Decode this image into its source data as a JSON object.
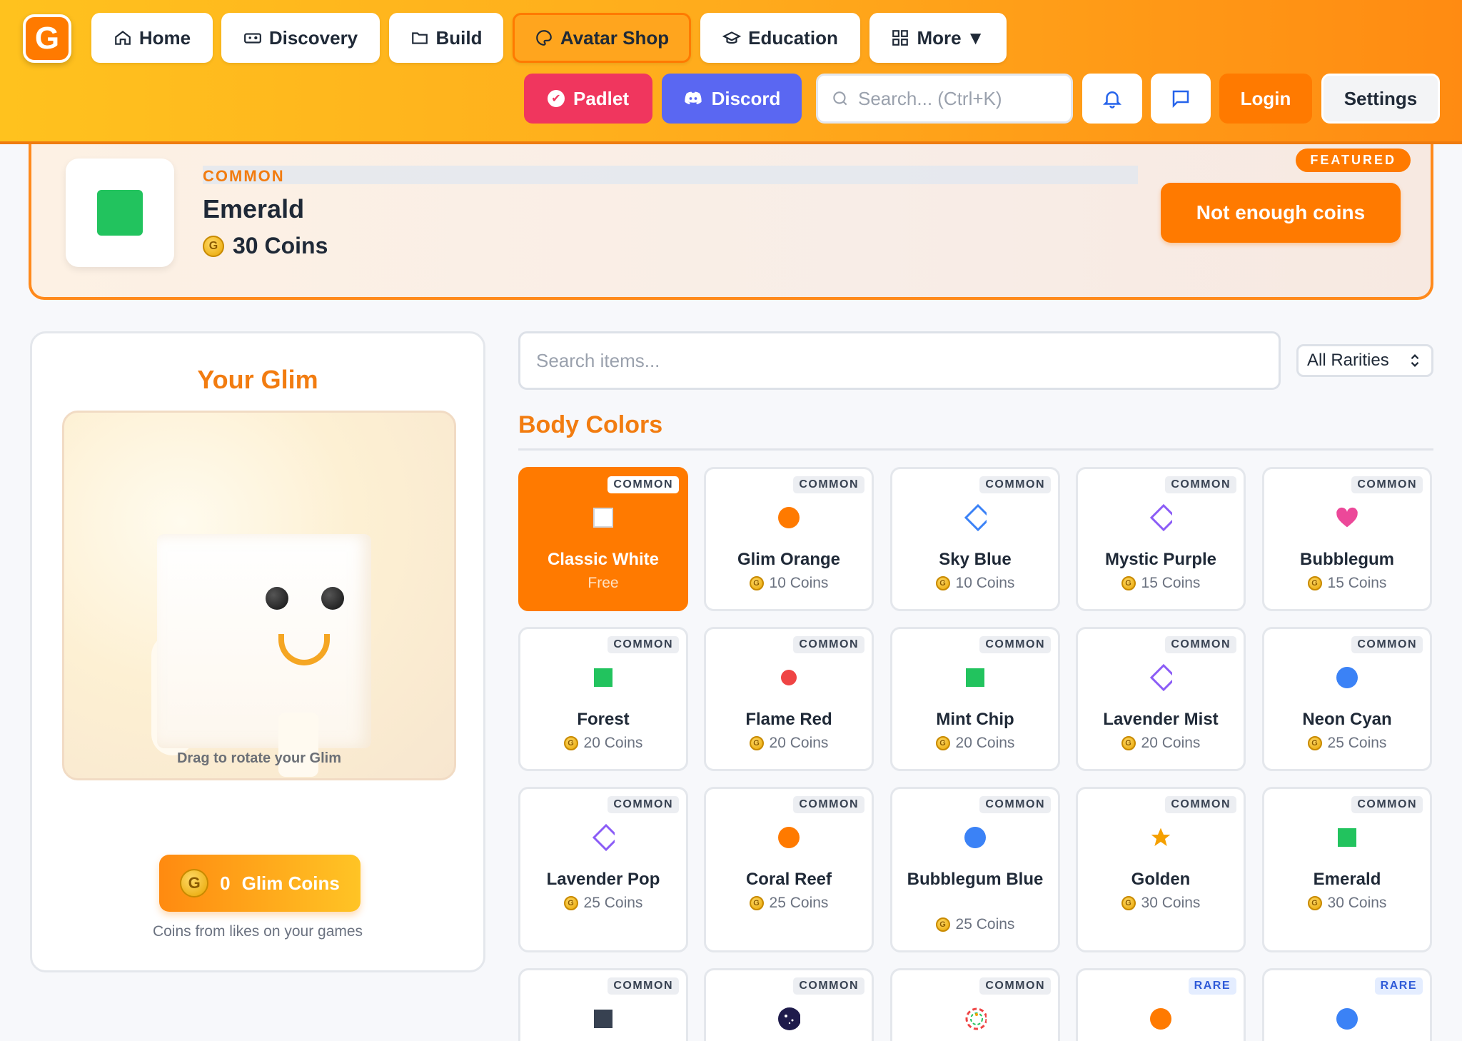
{
  "header": {
    "logo_letter": "G",
    "nav": [
      {
        "label": "Home",
        "icon": "home-icon"
      },
      {
        "label": "Discovery",
        "icon": "gamepad-icon"
      },
      {
        "label": "Build",
        "icon": "folder-icon"
      },
      {
        "label": "Avatar Shop",
        "icon": "palette-icon",
        "active": true
      },
      {
        "label": "Education",
        "icon": "graduation-cap-icon"
      },
      {
        "label": "More ▼",
        "icon": "grid-icon"
      }
    ],
    "padlet_label": "Padlet",
    "discord_label": "Discord",
    "search_placeholder": "Search... (Ctrl+K)",
    "login_label": "Login",
    "settings_label": "Settings"
  },
  "featured": {
    "badge": "FEATURED",
    "rarity": "COMMON",
    "name": "Emerald",
    "price": "30 Coins",
    "color": "#22c35e",
    "button_label": "Not enough coins"
  },
  "glim": {
    "title": "Your Glim",
    "drag_hint": "Drag to rotate your Glim",
    "coins_count": "0",
    "coins_label": "Glim Coins",
    "caption": "Coins from likes on your games"
  },
  "shop": {
    "search_placeholder": "Search items...",
    "rarity_filter": "All Rarities",
    "section_title": "Body Colors",
    "items": [
      {
        "name": "Classic White",
        "price": "Free",
        "rarity": "COMMON",
        "shape": "square-outline",
        "color": "#ffffff",
        "selected": true
      },
      {
        "name": "Glim Orange",
        "price": "10 Coins",
        "rarity": "COMMON",
        "shape": "circle",
        "color": "#ff7a00"
      },
      {
        "name": "Sky Blue",
        "price": "10 Coins",
        "rarity": "COMMON",
        "shape": "diamond",
        "color": "#3b82f6"
      },
      {
        "name": "Mystic Purple",
        "price": "15 Coins",
        "rarity": "COMMON",
        "shape": "diamond",
        "color": "#8b5cf6"
      },
      {
        "name": "Bubblegum",
        "price": "15 Coins",
        "rarity": "COMMON",
        "shape": "heart",
        "color": "#ec4899"
      },
      {
        "name": "Forest",
        "price": "20 Coins",
        "rarity": "COMMON",
        "shape": "square",
        "color": "#22c35e"
      },
      {
        "name": "Flame Red",
        "price": "20 Coins",
        "rarity": "COMMON",
        "shape": "small-circle",
        "color": "#ef4444"
      },
      {
        "name": "Mint Chip",
        "price": "20 Coins",
        "rarity": "COMMON",
        "shape": "square",
        "color": "#22c35e"
      },
      {
        "name": "Lavender Mist",
        "price": "20 Coins",
        "rarity": "COMMON",
        "shape": "diamond",
        "color": "#8b5cf6"
      },
      {
        "name": "Neon Cyan",
        "price": "25 Coins",
        "rarity": "COMMON",
        "shape": "circle",
        "color": "#3b82f6"
      },
      {
        "name": "Lavender Pop",
        "price": "25 Coins",
        "rarity": "COMMON",
        "shape": "diamond",
        "color": "#8b5cf6"
      },
      {
        "name": "Coral Reef",
        "price": "25 Coins",
        "rarity": "COMMON",
        "shape": "circle",
        "color": "#ff7a00"
      },
      {
        "name": "Bubblegum Blue",
        "price": "25 Coins",
        "rarity": "COMMON",
        "shape": "circle",
        "color": "#3b82f6"
      },
      {
        "name": "Golden",
        "price": "30 Coins",
        "rarity": "COMMON",
        "shape": "star",
        "color": "#f5a000"
      },
      {
        "name": "Emerald",
        "price": "30 Coins",
        "rarity": "COMMON",
        "shape": "square",
        "color": "#22c35e"
      },
      {
        "name": "",
        "price": "",
        "rarity": "COMMON",
        "shape": "square",
        "color": "#374151"
      },
      {
        "name": "",
        "price": "",
        "rarity": "COMMON",
        "shape": "galaxy",
        "color": "#1e1b4b"
      },
      {
        "name": "",
        "price": "",
        "rarity": "COMMON",
        "shape": "rainbow-ring",
        "color": "#ef4444"
      },
      {
        "name": "",
        "price": "",
        "rarity": "RARE",
        "shape": "circle",
        "color": "#ff7a00"
      },
      {
        "name": "",
        "price": "",
        "rarity": "RARE",
        "shape": "circle",
        "color": "#3b82f6"
      }
    ]
  }
}
